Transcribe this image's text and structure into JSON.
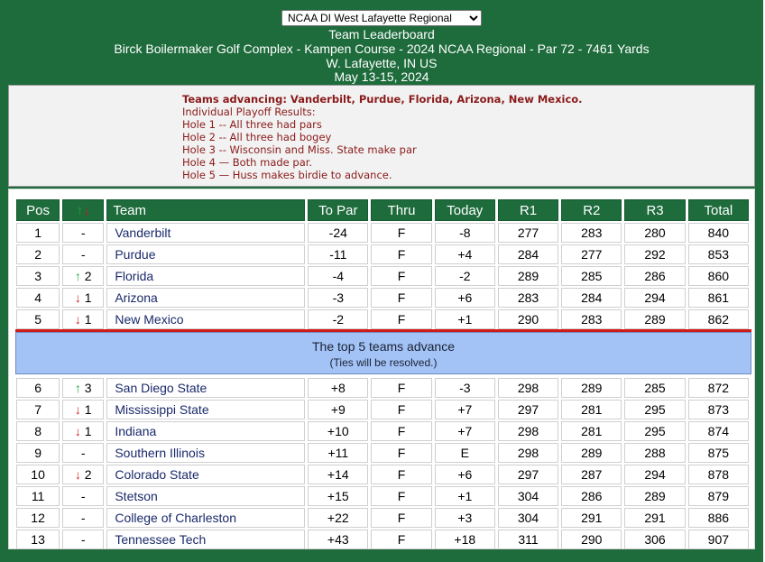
{
  "region_select": {
    "selected": "NCAA DI West Lafayette Regional"
  },
  "header": {
    "title": "Team Leaderboard",
    "course_line": "Birck Boilermaker Golf Complex - Kampen Course - 2024 NCAA Regional - Par 72 - 7461 Yards",
    "location": "W. Lafayette, IN US",
    "dates": "May 13-15, 2024"
  },
  "notes": {
    "advancing": "Teams advancing: Vanderbilt, Purdue, Florida, Arizona, New Mexico.",
    "playoff_title": "Individual Playoff Results:",
    "holes": [
      "Hole 1 -- All three had pars",
      "Hole 2 -- All three had bogey",
      "Hole 3 -- Wisconsin and Miss. State make par",
      "Hole 4 — Both made par.",
      "Hole 5 — Huss makes birdie to advance."
    ]
  },
  "columns": [
    "Pos",
    "↑↓",
    "Team",
    "To Par",
    "Thru",
    "Today",
    "R1",
    "R2",
    "R3",
    "Total"
  ],
  "advancing_rows": [
    {
      "pos": "1",
      "dir": "",
      "move": "-",
      "team": "Vanderbilt",
      "topar": "-24",
      "thru": "F",
      "today": "-8",
      "r1": "277",
      "r2": "283",
      "r3": "280",
      "total": "840"
    },
    {
      "pos": "2",
      "dir": "",
      "move": "-",
      "team": "Purdue",
      "topar": "-11",
      "thru": "F",
      "today": "+4",
      "r1": "284",
      "r2": "277",
      "r3": "292",
      "total": "853"
    },
    {
      "pos": "3",
      "dir": "↑",
      "move": "2",
      "team": "Florida",
      "topar": "-4",
      "thru": "F",
      "today": "-2",
      "r1": "289",
      "r2": "285",
      "r3": "286",
      "total": "860"
    },
    {
      "pos": "4",
      "dir": "↓",
      "move": "1",
      "team": "Arizona",
      "topar": "-3",
      "thru": "F",
      "today": "+6",
      "r1": "283",
      "r2": "284",
      "r3": "294",
      "total": "861"
    },
    {
      "pos": "5",
      "dir": "↓",
      "move": "1",
      "team": "New Mexico",
      "topar": "-2",
      "thru": "F",
      "today": "+1",
      "r1": "290",
      "r2": "283",
      "r3": "289",
      "total": "862"
    }
  ],
  "cut": {
    "main": "The top 5 teams advance",
    "sub": "(Ties will be resolved.)"
  },
  "other_rows": [
    {
      "pos": "6",
      "dir": "↑",
      "move": "3",
      "team": "San Diego State",
      "topar": "+8",
      "thru": "F",
      "today": "-3",
      "r1": "298",
      "r2": "289",
      "r3": "285",
      "total": "872"
    },
    {
      "pos": "7",
      "dir": "↓",
      "move": "1",
      "team": "Mississippi State",
      "topar": "+9",
      "thru": "F",
      "today": "+7",
      "r1": "297",
      "r2": "281",
      "r3": "295",
      "total": "873"
    },
    {
      "pos": "8",
      "dir": "↓",
      "move": "1",
      "team": "Indiana",
      "topar": "+10",
      "thru": "F",
      "today": "+7",
      "r1": "298",
      "r2": "281",
      "r3": "295",
      "total": "874"
    },
    {
      "pos": "9",
      "dir": "",
      "move": "-",
      "team": "Southern Illinois",
      "topar": "+11",
      "thru": "F",
      "today": "E",
      "r1": "298",
      "r2": "289",
      "r3": "288",
      "total": "875"
    },
    {
      "pos": "10",
      "dir": "↓",
      "move": "2",
      "team": "Colorado State",
      "topar": "+14",
      "thru": "F",
      "today": "+6",
      "r1": "297",
      "r2": "287",
      "r3": "294",
      "total": "878"
    },
    {
      "pos": "11",
      "dir": "",
      "move": "-",
      "team": "Stetson",
      "topar": "+15",
      "thru": "F",
      "today": "+1",
      "r1": "304",
      "r2": "286",
      "r3": "289",
      "total": "879"
    },
    {
      "pos": "12",
      "dir": "",
      "move": "-",
      "team": "College of Charleston",
      "topar": "+22",
      "thru": "F",
      "today": "+3",
      "r1": "304",
      "r2": "291",
      "r3": "291",
      "total": "886"
    },
    {
      "pos": "13",
      "dir": "",
      "move": "-",
      "team": "Tennessee Tech",
      "topar": "+43",
      "thru": "F",
      "today": "+18",
      "r1": "311",
      "r2": "290",
      "r3": "306",
      "total": "907"
    }
  ]
}
